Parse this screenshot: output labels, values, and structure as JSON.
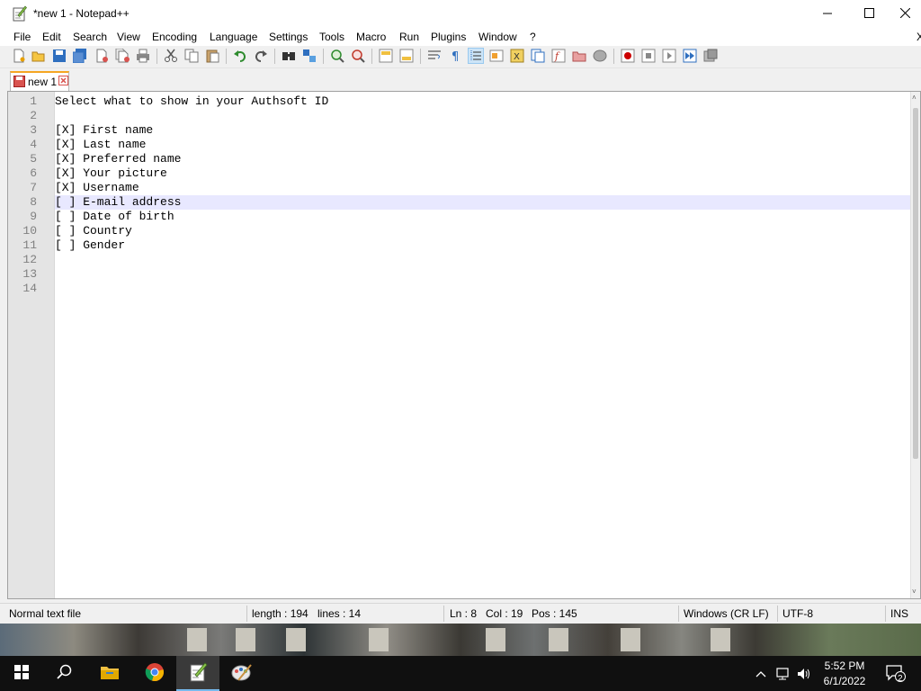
{
  "window": {
    "title": "*new 1 - Notepad++",
    "icons": {
      "app": "notepad-plus-plus-icon",
      "minimize": "minimize-icon",
      "maximize": "maximize-icon",
      "close": "close-icon"
    }
  },
  "menu": [
    "File",
    "Edit",
    "Search",
    "View",
    "Encoding",
    "Language",
    "Settings",
    "Tools",
    "Macro",
    "Run",
    "Plugins",
    "Window",
    "?"
  ],
  "menu_close": "X",
  "toolbar": [
    "new-file-icon",
    "open-file-icon",
    "save-icon",
    "save-all-icon",
    "close-icon",
    "close-all-icon",
    "print-icon",
    "cut-icon",
    "copy-icon",
    "paste-icon",
    "undo-icon",
    "redo-icon",
    "find-icon",
    "replace-icon",
    "zoom-in-icon",
    "zoom-out-icon",
    "sync-vertical-icon",
    "sync-horizontal-icon",
    "word-wrap-icon",
    "show-all-characters-icon",
    "indent-guide-icon",
    "user-defined-language-icon",
    "document-map-icon",
    "document-list-icon",
    "function-list-icon",
    "folder-as-workspace-icon",
    "monitoring-icon",
    "record-macro-icon",
    "stop-recording-icon",
    "play-macro-icon",
    "run-macro-multiple-icon",
    "save-macro-icon"
  ],
  "tab": {
    "label": "new 1",
    "icon": "unsaved-file-icon",
    "close_icon": "tab-close-icon"
  },
  "editor": {
    "current_line": 8,
    "lines": [
      "Select what to show in your Authsoft ID",
      "",
      "[X] First name",
      "[X] Last name",
      "[X] Preferred name",
      "[X] Your picture",
      "[X] Username",
      "[ ] E-mail address",
      "[ ] Date of birth",
      "[ ] Country",
      "[ ] Gender",
      "",
      "",
      ""
    ],
    "line_numbers": [
      "1",
      "2",
      "3",
      "4",
      "5",
      "6",
      "7",
      "8",
      "9",
      "10",
      "11",
      "12",
      "13",
      "14"
    ],
    "scroll_up": "˄",
    "scroll_down": "˅"
  },
  "status": {
    "file_type": "Normal text file",
    "length": "length : 194",
    "lines": "lines : 14",
    "ln": "Ln : 8",
    "col": "Col : 19",
    "pos": "Pos : 145",
    "eol": "Windows (CR LF)",
    "encoding": "UTF-8",
    "mode": "INS"
  },
  "taskbar": {
    "items": [
      "start-icon",
      "search-icon",
      "file-explorer-icon",
      "chrome-icon",
      "notepad-plus-plus-icon",
      "paint-icon"
    ],
    "active": "notepad-plus-plus-icon",
    "tray": [
      "show-hidden-icons-icon",
      "network-icon",
      "volume-icon"
    ],
    "time": "5:52 PM",
    "date": "6/1/2022",
    "notifications": "2"
  },
  "colors": {
    "current_line_bg": "#e8e8ff",
    "gutter_bg": "#e4e4e4",
    "line_number": "#808080",
    "tab_accent": "#f5a623",
    "taskbar": "#101010"
  }
}
